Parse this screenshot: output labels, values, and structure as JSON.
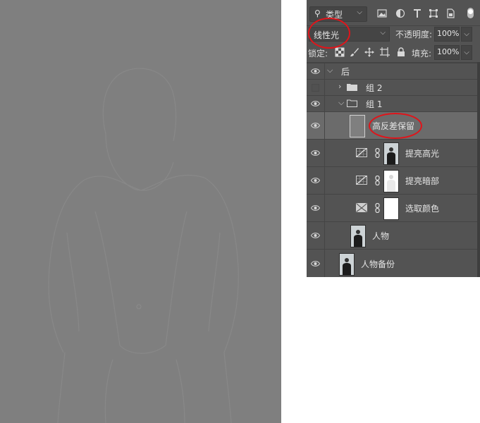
{
  "colors": {
    "canvas_gray": "#7f7f7f",
    "panel_bg": "#535353",
    "selected_layer": "#6b6b6b",
    "annotation_red": "#e0141a"
  },
  "canvas": {
    "content": "high-pass filtered portrait (faint gray outline of a person)"
  },
  "panel": {
    "filter": {
      "search_icon": "magnifier-icon",
      "kind_label": "类型",
      "icons": [
        "image-filter-icon",
        "adjustment-filter-icon",
        "type-filter-icon",
        "shape-filter-icon",
        "smart-object-filter-icon",
        "filter-toggle-icon"
      ]
    },
    "blend": {
      "mode": "线性光",
      "opacity_label": "不透明度:",
      "opacity_value": "100%"
    },
    "lock": {
      "label": "锁定:",
      "icons": [
        "lock-transparent-icon",
        "lock-brush-icon",
        "lock-move-icon",
        "lock-artboard-icon",
        "lock-all-icon"
      ],
      "fill_label": "填充:",
      "fill_value": "100%"
    },
    "layers": [
      {
        "name": "后",
        "type": "group",
        "visible": true,
        "expanded": true
      },
      {
        "name": "组 2",
        "type": "group",
        "visible": false,
        "expanded": false
      },
      {
        "name": "组 1",
        "type": "group",
        "visible": true,
        "expanded": true
      },
      {
        "name": "高反差保留",
        "type": "pixel",
        "visible": true,
        "selected": true
      },
      {
        "name": "提亮高光",
        "type": "curves-adjustment",
        "visible": true
      },
      {
        "name": "提亮暗部",
        "type": "curves-adjustment",
        "visible": true
      },
      {
        "name": "选取颜色",
        "type": "selective-color",
        "visible": true
      },
      {
        "name": "人物",
        "type": "pixel",
        "visible": true
      },
      {
        "name": "人物备份",
        "type": "pixel",
        "visible": true
      }
    ]
  }
}
